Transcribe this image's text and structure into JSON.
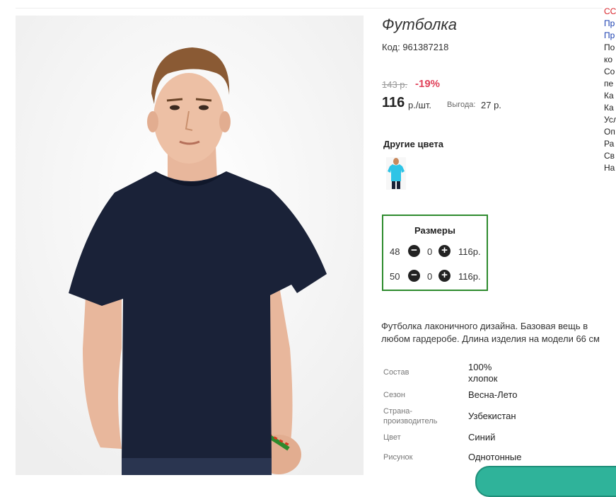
{
  "product": {
    "title": "Футболка",
    "code": "Код: 961387218",
    "old_price": "143 р.",
    "discount": "-19%",
    "price": "116",
    "price_unit": "р./шт.",
    "benefit_label": "Выгода:",
    "benefit_value": "27 р.",
    "colors_title": "Другие цвета",
    "swatch_color": "#2ec4e6",
    "main_color": "#1a2238"
  },
  "sizes": {
    "title": "Размеры",
    "rows": [
      {
        "size": "48",
        "qty": "0",
        "price": "116р."
      },
      {
        "size": "50",
        "qty": "0",
        "price": "116р."
      }
    ],
    "minus_glyph": "−",
    "plus_glyph": "+",
    "border_color": "#2e8b2e"
  },
  "description": [
    "Футболка лаконичного дизайна. Базовая вещь в",
    "любом гардеробе. Длина изделия на модели 66 см"
  ],
  "specs": [
    {
      "label": "Состав",
      "value_lines": [
        "100%",
        "хлопок"
      ]
    },
    {
      "label": "Сезон",
      "value_lines": [
        "Весна-Лето"
      ]
    },
    {
      "label": "Страна-\nпроизводитель",
      "value_lines": [
        "Узбекистан"
      ]
    },
    {
      "label": "Цвет",
      "value_lines": [
        "Синий"
      ]
    },
    {
      "label": "Рисунок",
      "value_lines": [
        "Однотонные"
      ]
    }
  ],
  "side_links": [
    "СС",
    "Пр",
    "Пр",
    "По",
    "ко",
    "Со",
    "пе",
    "Ка",
    "Ка",
    "Усл",
    "Оп",
    "Ра",
    "Св",
    "На"
  ],
  "accent_red": "#e0425a"
}
